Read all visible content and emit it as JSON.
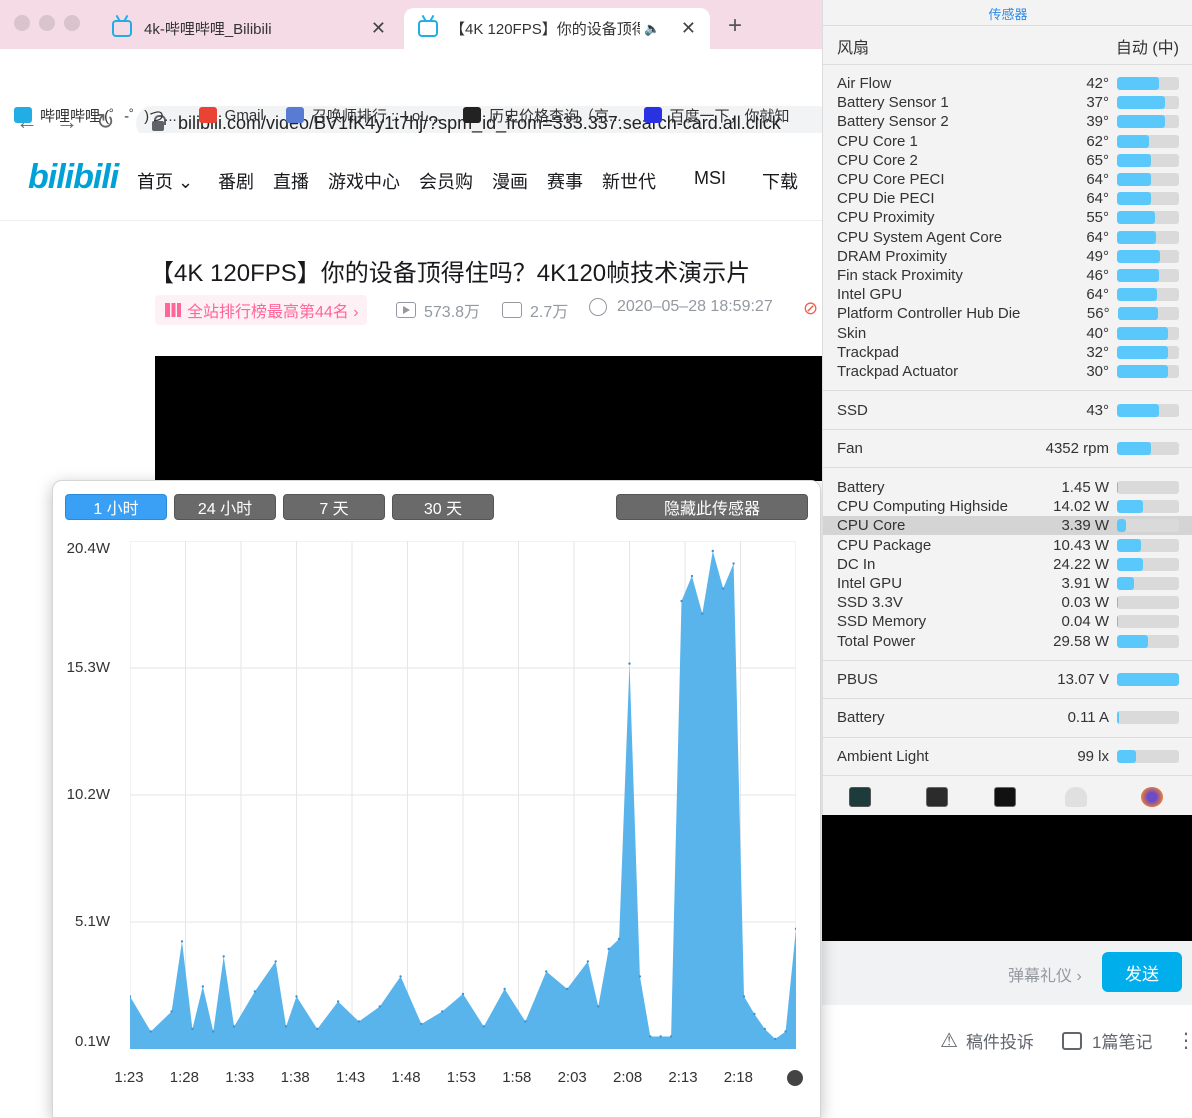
{
  "browser": {
    "tabs": [
      {
        "label": "4k-哔哩哔哩_Bilibili"
      },
      {
        "label": "【4K 120FPS】你的设备顶得",
        "audio": "🔈"
      }
    ],
    "close_glyph": "✕",
    "newtab_glyph": "+",
    "url": "bilibili.com/video/BV1fK4y1t7hj/?spm_id_from=333.337.search-card.all.click",
    "bookmarks": [
      {
        "label": "哔哩哔哩 (゜-゜)つ...",
        "color": "#23ade5"
      },
      {
        "label": "Gmail",
        "color": "#ea4335"
      },
      {
        "label": "召唤师排行 :: LoL...",
        "color": "#5a7bd4"
      },
      {
        "label": "历史价格查询（京...",
        "color": "#222222"
      },
      {
        "label": "百度一下，你就知",
        "color": "#2932e1"
      }
    ]
  },
  "site": {
    "logo": "bilibili",
    "menu": [
      "首页 ⌄",
      "番剧",
      "直播",
      "游戏中心",
      "会员购",
      "漫画",
      "赛事",
      "新世代",
      "MSI",
      "下载"
    ],
    "video_title": "【4K 120FPS】你的设备顶得住吗？4K120帧技术演示片",
    "rank_badge": "全站排行榜最高第44名 ›",
    "views": "573.8万",
    "danmaku": "2.7万",
    "date": "2020–05–28 18:59:27",
    "danmu_gift": "弹幕礼仪 ›",
    "danmu_send": "发送",
    "report": "稿件投诉",
    "notes": "1篇笔记"
  },
  "graph": {
    "buttons": [
      "1 小时",
      "24 小时",
      "7 天",
      "30 天"
    ],
    "hide_button": "隐藏此传感器",
    "accent": "#5ab4ec"
  },
  "chart_data": {
    "type": "area",
    "ylabels": [
      "20.4W",
      "15.3W",
      "10.2W",
      "5.1W",
      "0.1W"
    ],
    "xlabels": [
      "1:23",
      "1:28",
      "1:33",
      "1:38",
      "1:43",
      "1:48",
      "1:53",
      "1:58",
      "2:03",
      "2:08",
      "2:13",
      "2:18"
    ],
    "ylim": [
      0.1,
      20.4
    ],
    "x_minutes": [
      0,
      2,
      4,
      5,
      6,
      7,
      8,
      9,
      10,
      12,
      14,
      15,
      16,
      18,
      20,
      22,
      24,
      26,
      28,
      30,
      32,
      34,
      36,
      38,
      40,
      42,
      44,
      45,
      46,
      47,
      48,
      49,
      50,
      51,
      52,
      53,
      54,
      55,
      56,
      57,
      58,
      59,
      60,
      61,
      62,
      63,
      64
    ],
    "values": [
      2.2,
      0.8,
      1.6,
      4.4,
      0.9,
      2.6,
      0.8,
      3.8,
      1.0,
      2.4,
      3.6,
      1.0,
      2.2,
      0.9,
      2.0,
      1.2,
      1.8,
      3.0,
      1.1,
      1.6,
      2.3,
      1.0,
      2.5,
      1.2,
      3.2,
      2.5,
      3.6,
      1.8,
      4.1,
      4.5,
      15.5,
      3.0,
      0.6,
      0.6,
      0.6,
      18.0,
      19.0,
      17.5,
      20.0,
      18.5,
      19.5,
      2.2,
      1.5,
      0.9,
      0.5,
      0.8,
      4.9
    ],
    "grid": true,
    "color": "#5ab4ec"
  },
  "sensors": {
    "title": "传感器",
    "fan_header": {
      "name": "风扇",
      "value": "自动 (中)"
    },
    "temps": [
      {
        "name": "Air Flow",
        "value": "42°",
        "level": 0.68
      },
      {
        "name": "Battery Sensor 1",
        "value": "37°",
        "level": 0.78
      },
      {
        "name": "Battery Sensor 2",
        "value": "39°",
        "level": 0.78
      },
      {
        "name": "CPU Core 1",
        "value": "62°",
        "level": 0.52
      },
      {
        "name": "CPU Core 2",
        "value": "65°",
        "level": 0.55
      },
      {
        "name": "CPU Core PECI",
        "value": "64°",
        "level": 0.55
      },
      {
        "name": "CPU Die PECI",
        "value": "64°",
        "level": 0.55
      },
      {
        "name": "CPU Proximity",
        "value": "55°",
        "level": 0.62
      },
      {
        "name": "CPU System Agent Core",
        "value": "64°",
        "level": 0.63
      },
      {
        "name": "DRAM Proximity",
        "value": "49°",
        "level": 0.7
      },
      {
        "name": "Fin stack Proximity",
        "value": "46°",
        "level": 0.68
      },
      {
        "name": "Intel GPU",
        "value": "64°",
        "level": 0.65
      },
      {
        "name": "Platform Controller Hub Die",
        "value": "56°",
        "level": 0.65
      },
      {
        "name": "Skin",
        "value": "40°",
        "level": 0.82
      },
      {
        "name": "Trackpad",
        "value": "32°",
        "level": 0.82
      },
      {
        "name": "Trackpad Actuator",
        "value": "30°",
        "level": 0.82
      }
    ],
    "ssd": {
      "name": "SSD",
      "value": "43°",
      "level": 0.68
    },
    "fan": {
      "name": "Fan",
      "value": "4352 rpm",
      "level": 0.55
    },
    "power": [
      {
        "name": "Battery",
        "value": "1.45 W",
        "level": 0.02
      },
      {
        "name": "CPU Computing Highside",
        "value": "14.02 W",
        "level": 0.42
      },
      {
        "name": "CPU Core",
        "value": "3.39 W",
        "level": 0.15
      },
      {
        "name": "CPU Package",
        "value": "10.43 W",
        "level": 0.38
      },
      {
        "name": "DC In",
        "value": "24.22 W",
        "level": 0.42
      },
      {
        "name": "Intel GPU",
        "value": "3.91 W",
        "level": 0.28
      },
      {
        "name": "SSD 3.3V",
        "value": "0.03 W",
        "level": 0.01
      },
      {
        "name": "SSD Memory",
        "value": "0.04 W",
        "level": 0.01
      },
      {
        "name": "Total Power",
        "value": "29.58 W",
        "level": 0.5
      }
    ],
    "pbus": {
      "name": "PBUS",
      "value": "13.07 V",
      "level": 1.0
    },
    "current": {
      "name": "Battery",
      "value": "0.11 A",
      "level": 0.03
    },
    "light": {
      "name": "Ambient Light",
      "value": "99 lx",
      "level": 0.3
    }
  }
}
